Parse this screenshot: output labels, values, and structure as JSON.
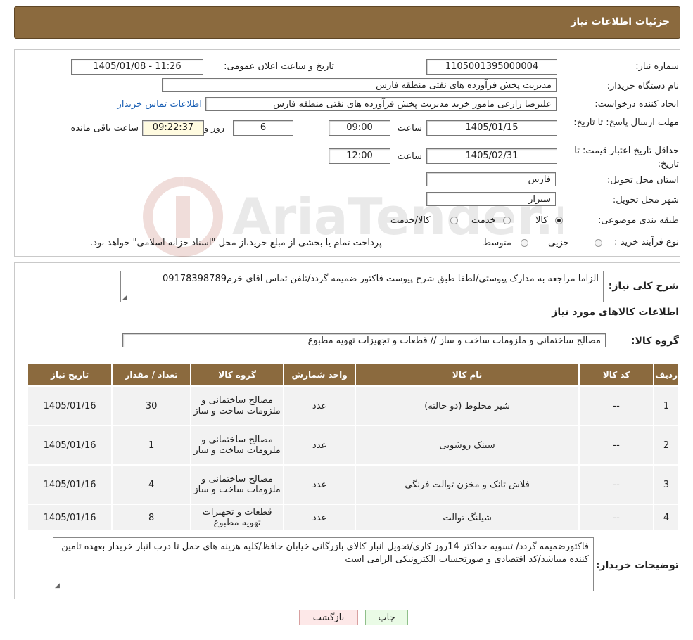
{
  "header": {
    "title": "جزئیات اطلاعات نیاز"
  },
  "form": {
    "need_number": {
      "label": "شماره نیاز:",
      "value": "1105001395000004"
    },
    "announce_datetime": {
      "label": "تاریخ و ساعت اعلان عمومی:",
      "value": "1405/01/08 - 11:26"
    },
    "buyer_org": {
      "label": "نام دستگاه خریدار:",
      "value": "مدیریت پخش فرآورده های نفتی منطقه فارس"
    },
    "requester": {
      "label": "ایجاد کننده درخواست:",
      "value": "علیرضا زارعی مامور خرید مدیریت پخش فرآورده های نفتی منطقه فارس",
      "contact_link": "اطلاعات تماس خریدار"
    },
    "deadline": {
      "label": "مهلت ارسال پاسخ: تا تاریخ:",
      "date": "1405/01/15",
      "time_label": "ساعت",
      "time": "09:00",
      "days": "6",
      "days_label": "روز و",
      "remaining": "09:22:37",
      "remaining_label": "ساعت باقی مانده"
    },
    "validity": {
      "label": "حداقل تاریخ اعتبار قیمت: تا تاریخ:",
      "date": "1405/02/31",
      "time_label": "ساعت",
      "time": "12:00"
    },
    "province": {
      "label": "استان محل تحویل:",
      "value": "فارس"
    },
    "city": {
      "label": "شهر محل تحویل:",
      "value": "شیراز"
    },
    "category": {
      "label": "طبقه بندی موضوعی:",
      "options": [
        "کالا",
        "خدمت",
        "کالا/خدمت"
      ],
      "selected": "کالا"
    },
    "purchase_type": {
      "label": "نوع فرآیند خرید :",
      "options": [
        "جزیی",
        "متوسط"
      ],
      "note": "پرداخت تمام یا بخشی از مبلغ خرید،از محل \"اسناد خزانه اسلامی\" خواهد بود."
    }
  },
  "summary": {
    "label": "شرح کلی نیاز:",
    "text": "الزاما مراجعه به مدارک پیوستی/لطفا طبق شرح پیوست فاکتور ضمیمه گردد/تلفن تماس اقای خرم09178398789"
  },
  "goods": {
    "section_title": "اطلاعات کالاهای مورد نیاز",
    "group_label": "گروه کالا:",
    "group_value": "مصالح ساختمانی و ملزومات ساخت و ساز //  قطعات و تجهیزات تهویه مطبوع",
    "columns": [
      "ردیف",
      "کد کالا",
      "نام کالا",
      "واحد شمارش",
      "گروه کالا",
      "تعداد / مقدار",
      "تاریخ نیاز"
    ],
    "rows": [
      [
        "1",
        "--",
        "شیر مخلوط (دو حالته)",
        "عدد",
        "مصالح ساختمانی و ملزومات ساخت و ساز",
        "30",
        "1405/01/16"
      ],
      [
        "2",
        "--",
        "سینک روشویی",
        "عدد",
        "مصالح ساختمانی و ملزومات ساخت و ساز",
        "1",
        "1405/01/16"
      ],
      [
        "3",
        "--",
        "فلاش تانک و مخزن توالت فرنگی",
        "عدد",
        "مصالح ساختمانی و ملزومات ساخت و ساز",
        "4",
        "1405/01/16"
      ],
      [
        "4",
        "--",
        "شیلنگ توالت",
        "عدد",
        "قطعات و تجهیزات تهویه مطبوع",
        "8",
        "1405/01/16"
      ]
    ]
  },
  "buyer_notes": {
    "label": "توضیحات خریدار:",
    "text": "فاکتورضمیمه گردد/ تسویه حداکثر 14روز کاری/تحویل انبار کالای بازرگانی خیابان حافظ/کلیه هزینه های حمل تا درب انبار خریدار بعهده تامین کننده میباشد/کد اقتصادی و صورتحساب الکترونیکی الزامی است"
  },
  "buttons": {
    "print": "چاپ",
    "back": "بازگشت"
  },
  "watermark_text": "AriaTender.neT",
  "colors": {
    "header": "#8b6a3e",
    "link": "#1a5fb4"
  }
}
